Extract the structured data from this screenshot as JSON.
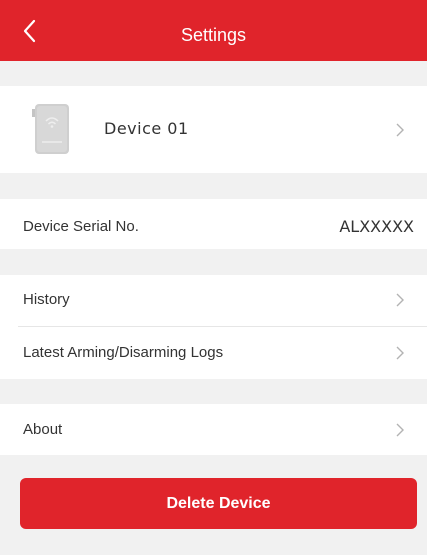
{
  "header": {
    "title": "Settings"
  },
  "device": {
    "name": "Device 01"
  },
  "serial": {
    "label": "Device Serial No.",
    "value": "ALXXXXX"
  },
  "menu": {
    "history_label": "History",
    "logs_label": "Latest Arming/Disarming Logs",
    "about_label": "About"
  },
  "actions": {
    "delete_label": "Delete Device"
  },
  "colors": {
    "accent": "#e0242b",
    "background": "#f1f1f1",
    "surface": "#ffffff"
  }
}
